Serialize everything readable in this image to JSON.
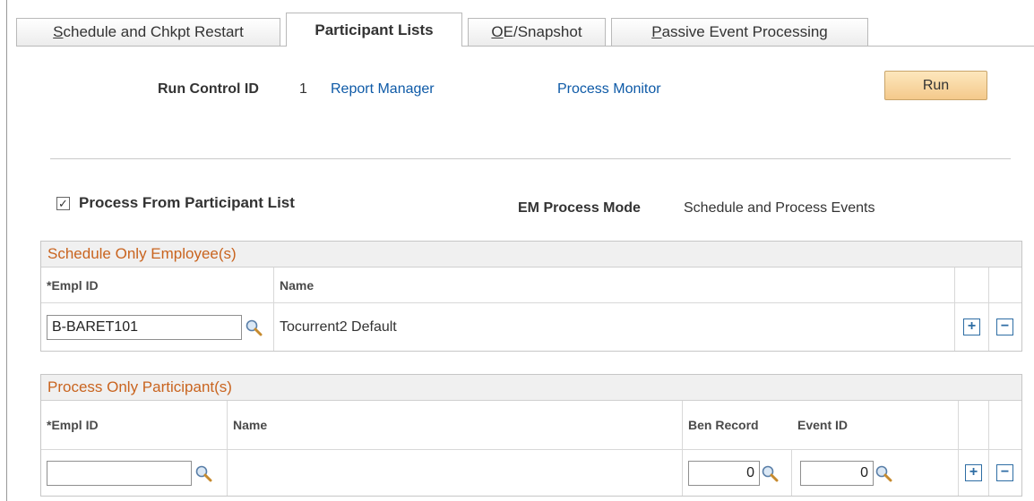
{
  "tabs": [
    {
      "prefix": "",
      "underline": "S",
      "rest": "chedule and Chkpt Restart"
    },
    {
      "prefix": "",
      "underline": "",
      "rest": "Participant Lists"
    },
    {
      "prefix": "",
      "underline": "O",
      "rest": "E/Snapshot"
    },
    {
      "prefix": "",
      "underline": "P",
      "rest": "assive Event Processing"
    }
  ],
  "header": {
    "run_control_label": "Run Control ID",
    "run_control_value": "1",
    "report_manager": "Report Manager",
    "process_monitor": "Process Monitor",
    "run_label": "Run"
  },
  "options": {
    "checkbox_mark": "☑",
    "process_from_list_label": "Process From Participant List",
    "em_mode_label": "EM Process Mode",
    "em_mode_value": "Schedule and Process Events"
  },
  "schedule_grid": {
    "title": "Schedule Only Employee(s)",
    "col_emplid": "*Empl ID",
    "col_name": "Name",
    "row": {
      "emplid": "B-BARET101",
      "name": "Tocurrent2 Default"
    }
  },
  "process_grid": {
    "title": "Process Only Participant(s)",
    "col_emplid": "*Empl ID",
    "col_name": "Name",
    "col_ben_record": "Ben Record",
    "col_event_id": "Event ID",
    "row": {
      "emplid": "",
      "name": "",
      "ben_record": "0",
      "event_id": "0"
    }
  },
  "buttons": {
    "add": "+",
    "remove": "−"
  },
  "icons": {
    "lookup": "magnifier-icon"
  },
  "colors": {
    "link": "#0e5aa7",
    "grid_title": "#c9641f",
    "run_button": "#f4c98b",
    "action_border": "#2e6da4"
  }
}
